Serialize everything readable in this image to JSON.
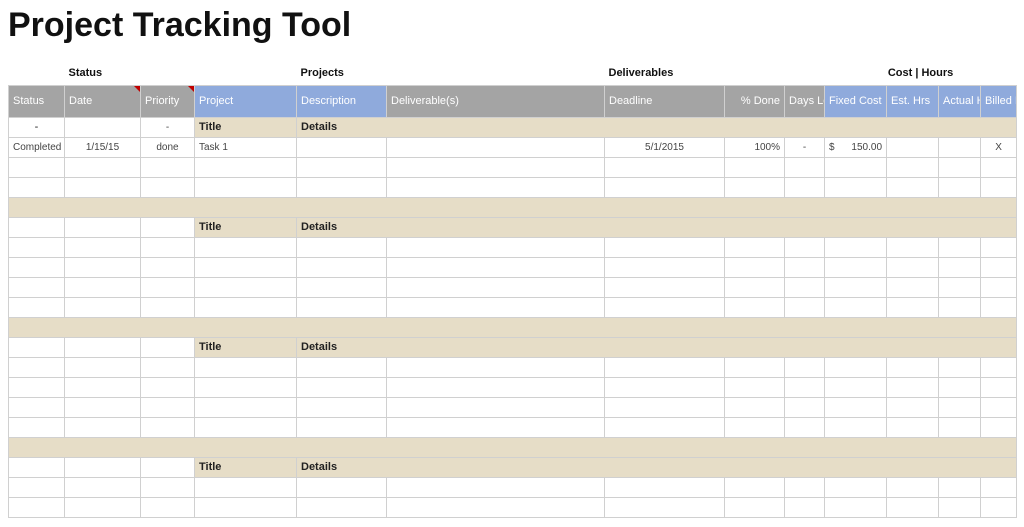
{
  "title": "Project Tracking Tool",
  "groups": {
    "status": "Status",
    "projects": "Projects",
    "deliverables": "Deliverables",
    "cost_hours": "Cost | Hours"
  },
  "columns": {
    "status": "Status",
    "date": "Date",
    "priority": "Priority",
    "project": "Project",
    "description": "Description",
    "deliverables": "Deliverable(s)",
    "deadline": "Deadline",
    "pct_done": "% Done",
    "days_left": "Days Left",
    "fixed_cost": "Fixed Cost",
    "est_hrs": "Est. Hrs",
    "actual_hrs": "Actual Hrs",
    "billed_hrs": "Billed Hrs"
  },
  "section_labels": {
    "title": "Title",
    "details": "Details"
  },
  "placeholder_dash": "-",
  "rows": {
    "r1": {
      "status": "Completed",
      "date": "1/15/15",
      "priority": "done",
      "project": "Task 1",
      "description": "",
      "deliverables": "",
      "deadline": "5/1/2015",
      "pct_done": "100%",
      "days_left": "-",
      "fixed_cost_currency": "$",
      "fixed_cost_value": "150.00",
      "est_hrs": "",
      "actual_hrs": "",
      "billed_hrs": "X"
    }
  }
}
